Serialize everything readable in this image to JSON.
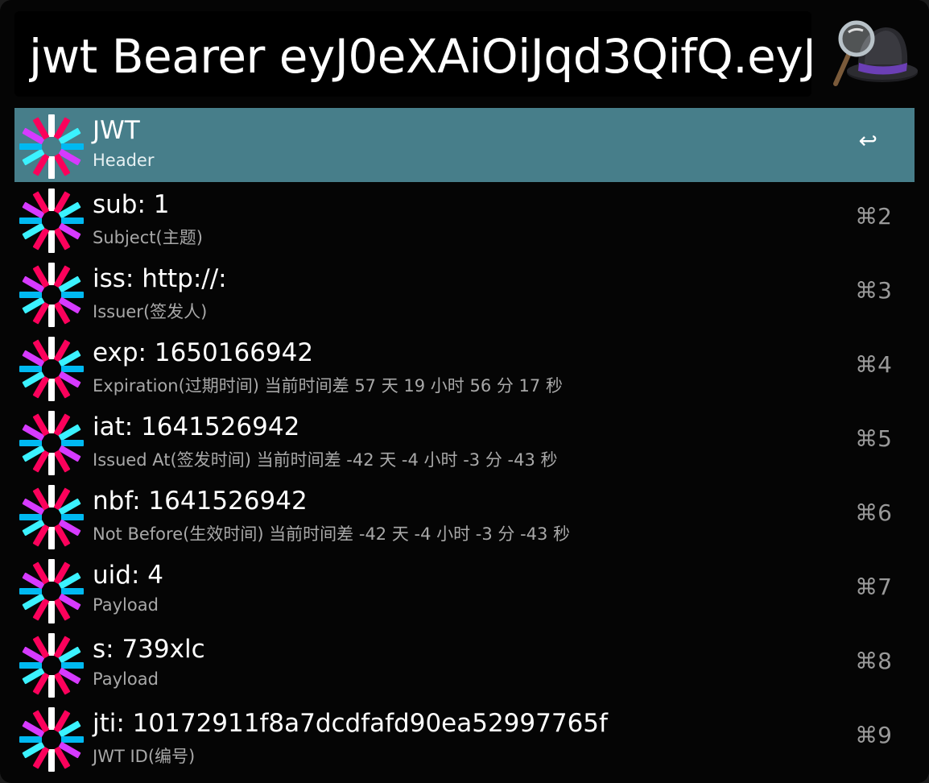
{
  "search": {
    "query": "jwt Bearer eyJ0eXAiOiJqd3QifQ.eyJ"
  },
  "app_icon": "alfred-hat-icon",
  "colors": {
    "selected_row": "#477e8a",
    "background": "#050505",
    "jwt_logo": [
      "#fb015b",
      "#d63aff",
      "#00b9f1",
      "#3bf2ff",
      "#ffffff"
    ]
  },
  "results": [
    {
      "title": "JWT",
      "subtitle": "Header",
      "shortcut": "↩",
      "selected": true,
      "icon": "jwt-logo-icon"
    },
    {
      "title": "sub: 1",
      "subtitle": "Subject(主题)",
      "shortcut": "⌘2",
      "icon": "jwt-logo-icon"
    },
    {
      "title": "iss: http://:",
      "subtitle": "Issuer(签发人)",
      "shortcut": "⌘3",
      "icon": "jwt-logo-icon"
    },
    {
      "title": "exp: 1650166942",
      "subtitle": "Expiration(过期时间) 当前时间差 57 天 19 小时 56 分 17 秒",
      "shortcut": "⌘4",
      "icon": "jwt-logo-icon"
    },
    {
      "title": "iat: 1641526942",
      "subtitle": "Issued At(签发时间) 当前时间差 -42 天 -4 小时 -3 分 -43 秒",
      "shortcut": "⌘5",
      "icon": "jwt-logo-icon"
    },
    {
      "title": "nbf: 1641526942",
      "subtitle": "Not Before(生效时间) 当前时间差 -42 天 -4 小时 -3 分 -43 秒",
      "shortcut": "⌘6",
      "icon": "jwt-logo-icon"
    },
    {
      "title": "uid: 4",
      "subtitle": "Payload",
      "shortcut": "⌘7",
      "icon": "jwt-logo-icon"
    },
    {
      "title": "s: 739xlc",
      "subtitle": "Payload",
      "shortcut": "⌘8",
      "icon": "jwt-logo-icon"
    },
    {
      "title": "jti: 10172911f8a7dcdfafd90ea52997765f",
      "subtitle": "JWT ID(编号)",
      "shortcut": "⌘9",
      "icon": "jwt-logo-icon"
    }
  ]
}
